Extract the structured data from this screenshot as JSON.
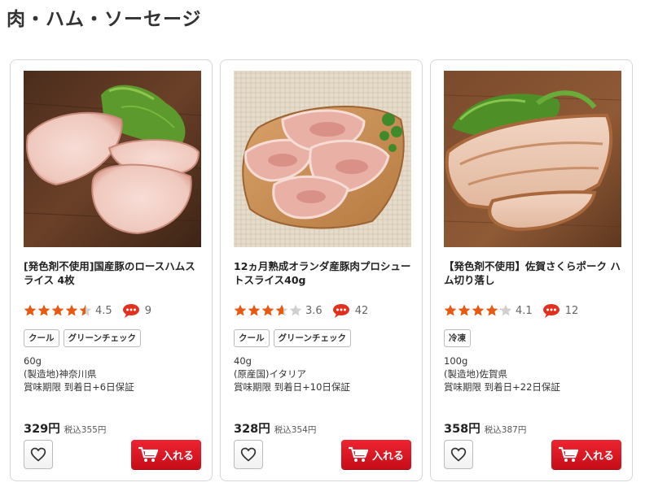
{
  "page": {
    "title": "肉・ハム・ソーセージ"
  },
  "colors": {
    "star": "#e75a0f",
    "star_empty": "#d0d0d0",
    "review_icon": "#e2301f",
    "cart_button": "#d71a24"
  },
  "icons": {
    "review": "speech-bubble-icon",
    "favorite": "heart-icon",
    "cart": "cart-icon"
  },
  "products": [
    {
      "image": "sliced-roast-ham-photo",
      "name": "[発色剤不使用]国産豚のロースハムスライス 4枚",
      "rating": 4.5,
      "rating_text": "4.5",
      "review_count": "9",
      "tags": [
        "クール",
        "グリーンチェック"
      ],
      "details": [
        "60g",
        "(製造地)神奈川県",
        "賞味期限 到着日+6日保証"
      ],
      "price": "329円",
      "price_tax": "税込355円",
      "cart_label": "入れる"
    },
    {
      "image": "prosciutto-photo",
      "name": "12ヵ月熟成オランダ産豚肉プロシュートスライス40g",
      "rating": 3.6,
      "rating_text": "3.6",
      "review_count": "42",
      "tags": [
        "クール",
        "グリーンチェック"
      ],
      "details": [
        "40g",
        "(原産国)イタリア",
        "賞味期限 到着日+10日保証"
      ],
      "price": "328円",
      "price_tax": "税込354円",
      "cart_label": "入れる"
    },
    {
      "image": "cut-pork-ham-photo",
      "name": "【発色剤不使用】佐賀さくらポーク ハム切り落し",
      "rating": 4.1,
      "rating_text": "4.1",
      "review_count": "12",
      "tags": [
        "冷凍"
      ],
      "details": [
        "100g",
        "(製造地)佐賀県",
        "賞味期限 到着日+22日保証"
      ],
      "price": "358円",
      "price_tax": "税込387円",
      "cart_label": "入れる"
    }
  ]
}
